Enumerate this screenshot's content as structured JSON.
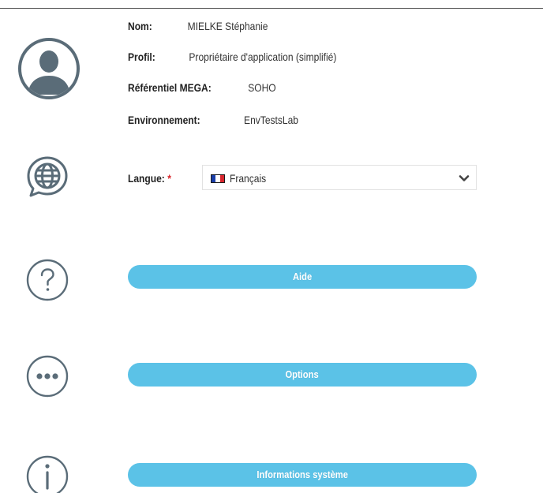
{
  "profile": {
    "nom_label": "Nom:",
    "nom_value": "MIELKE Stéphanie",
    "profil_label": "Profil:",
    "profil_value": "Propriétaire d'application (simplifié)",
    "referentiel_label": "Référentiel MEGA:",
    "referentiel_value": "SOHO",
    "environnement_label": "Environnement:",
    "environnement_value": "EnvTestsLab"
  },
  "language": {
    "label": "Langue:",
    "required_mark": "*",
    "selected": "Français",
    "flag": "france-flag"
  },
  "buttons": {
    "help_label": "Aide",
    "options_label": "Options",
    "system_info_label": "Informations système"
  },
  "icons": {
    "avatar": "user-avatar-icon",
    "language": "globe-speech-icon",
    "help": "question-circle-icon",
    "options": "more-circle-icon",
    "info": "info-circle-icon"
  },
  "colors": {
    "button": "#5bc2e7",
    "button_text": "#ffffff",
    "icon": "#5a6c78",
    "required": "#d9262b"
  }
}
